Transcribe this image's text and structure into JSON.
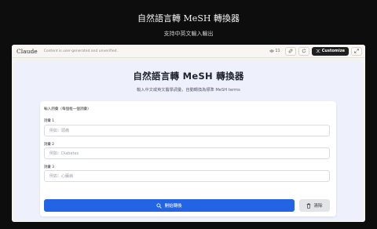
{
  "page": {
    "title": "自然語言轉 MeSH 轉換器",
    "subtitle": "支持中英文輸入輸出"
  },
  "window": {
    "brand": "Claude",
    "notice": "Content is user-generated and unverified.",
    "view_count": "11",
    "customize_label": "Customize"
  },
  "app": {
    "title": "自然語言轉 MeSH 轉換器",
    "subtitle": "輸入中文或英文醫學詞彙，自動轉換為標準 MeSH terms",
    "section_label": "輸入詞彙（每個框一個詞彙）",
    "fields": [
      {
        "label": "詞彙 1",
        "placeholder": "例如：頭痛"
      },
      {
        "label": "詞彙 2",
        "placeholder": "例如：Diabetes"
      },
      {
        "label": "詞彙 3",
        "placeholder": "例如：心臟病"
      }
    ],
    "convert_label": "開始轉換",
    "clear_label": "清除"
  },
  "colors": {
    "primary": "#2264e4",
    "background": "#0d0d0d",
    "app_bg": "#eef1fb"
  }
}
